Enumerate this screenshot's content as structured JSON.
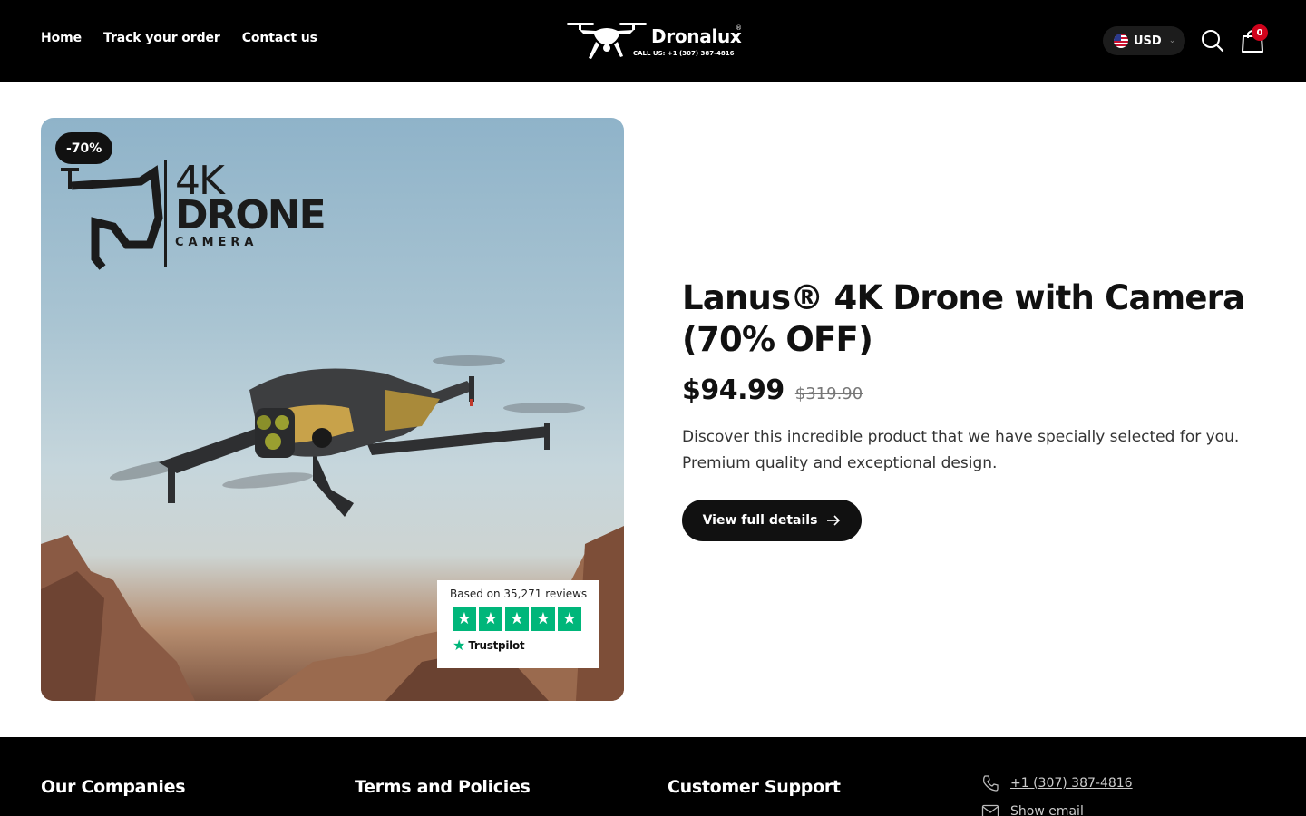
{
  "header": {
    "nav": [
      "Home",
      "Track your order",
      "Contact us"
    ],
    "logo": {
      "brand": "Dronalux",
      "trademark": "®",
      "phone": "CALL US: +1 (307) 387-4816"
    },
    "currency": {
      "code": "USD"
    },
    "cart_count": "0"
  },
  "product": {
    "badge": "-70%",
    "image_overlay": {
      "line1": "4K",
      "line2": "DRONE",
      "line3": "CAMERA"
    },
    "trust": {
      "text": "Based on 35,271 reviews",
      "brand": "Trustpilot",
      "stars": 5
    },
    "title": "Lanus® 4K Drone with Camera (70% OFF)",
    "price": "$94.99",
    "compare_price": "$319.90",
    "description": "Discover this incredible product that we have specially selected for you. Premium quality and exceptional design.",
    "cta": "View full details"
  },
  "footer": {
    "headings": [
      "Our Companies",
      "Terms and Policies",
      "Customer Support"
    ],
    "phone": "+1 (307) 387-4816",
    "email": "Show email"
  },
  "colors": {
    "header_bg": "#000000",
    "badge_red": "#d0021b",
    "trustpilot_green": "#00b67a",
    "button": "#111111"
  },
  "icons": [
    "search-icon",
    "cart-icon",
    "phone-icon",
    "mail-icon",
    "arrow-right-icon",
    "chevron-down-icon"
  ]
}
